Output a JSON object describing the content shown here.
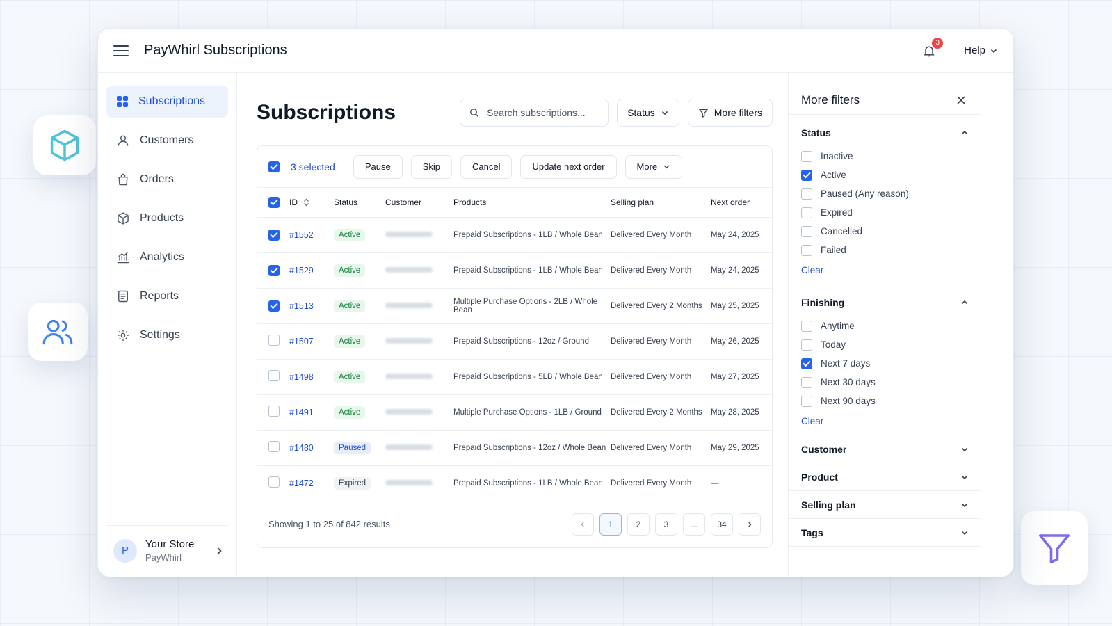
{
  "app": {
    "title": "PayWhirl Subscriptions",
    "notification_count": "3",
    "help_label": "Help"
  },
  "sidebar": {
    "items": [
      {
        "label": "Subscriptions",
        "icon": "grid-icon",
        "active": true
      },
      {
        "label": "Customers",
        "icon": "user-icon"
      },
      {
        "label": "Orders",
        "icon": "bag-icon"
      },
      {
        "label": "Products",
        "icon": "cube-icon"
      },
      {
        "label": "Analytics",
        "icon": "chart-icon"
      },
      {
        "label": "Reports",
        "icon": "document-icon"
      },
      {
        "label": "Settings",
        "icon": "gear-icon"
      }
    ],
    "footer": {
      "avatar_initial": "P",
      "store_name": "Your Store",
      "store_sub": "PayWhirl"
    }
  },
  "main": {
    "title": "Subscriptions",
    "search_placeholder": "Search subscriptions...",
    "status_filter_label": "Status",
    "more_filters_label": "More filters",
    "bulk": {
      "selected_label": "3 selected",
      "actions": [
        "Pause",
        "Skip",
        "Cancel",
        "Update next order"
      ],
      "more_label": "More"
    },
    "columns": {
      "id": "ID",
      "status": "Status",
      "customer": "Customer",
      "products": "Products",
      "plan": "Selling plan",
      "next": "Next order"
    },
    "rows": [
      {
        "checked": true,
        "id": "#1552",
        "status": "Active",
        "product": "Prepaid Subscriptions - 1LB / Whole Bean",
        "plan": "Delivered Every Month",
        "next": "May 24, 2025"
      },
      {
        "checked": true,
        "id": "#1529",
        "status": "Active",
        "product": "Prepaid Subscriptions - 1LB / Whole Bean",
        "plan": "Delivered Every Month",
        "next": "May 24, 2025"
      },
      {
        "checked": true,
        "id": "#1513",
        "status": "Active",
        "product": "Multiple Purchase Options - 2LB / Whole Bean",
        "plan": "Delivered Every 2 Months",
        "next": "May 25, 2025"
      },
      {
        "checked": false,
        "id": "#1507",
        "status": "Active",
        "product": "Prepaid Subscriptions - 12oz / Ground",
        "plan": "Delivered Every Month",
        "next": "May 26, 2025"
      },
      {
        "checked": false,
        "id": "#1498",
        "status": "Active",
        "product": "Prepaid Subscriptions - 5LB / Whole Bean",
        "plan": "Delivered Every Month",
        "next": "May 27, 2025"
      },
      {
        "checked": false,
        "id": "#1491",
        "status": "Active",
        "product": "Multiple Purchase Options - 1LB / Ground",
        "plan": "Delivered Every 2 Months",
        "next": "May 28, 2025"
      },
      {
        "checked": false,
        "id": "#1480",
        "status": "Paused",
        "product": "Prepaid Subscriptions - 12oz / Whole Bean",
        "plan": "Delivered Every Month",
        "next": "May 29, 2025"
      },
      {
        "checked": false,
        "id": "#1472",
        "status": "Expired",
        "product": "Prepaid Subscriptions - 1LB / Whole Bean",
        "plan": "Delivered Every Month",
        "next": "—"
      }
    ],
    "showing": "Showing 1 to 25 of 842 results",
    "pagination": {
      "pages": [
        "1",
        "2",
        "3",
        "...",
        "34"
      ],
      "current": "1"
    }
  },
  "filters": {
    "title": "More filters",
    "sections": [
      {
        "title": "Status",
        "expanded": true,
        "options": [
          {
            "label": "Inactive",
            "checked": false
          },
          {
            "label": "Active",
            "checked": true
          },
          {
            "label": "Paused (Any reason)",
            "checked": false
          },
          {
            "label": "Expired",
            "checked": false
          },
          {
            "label": "Cancelled",
            "checked": false
          },
          {
            "label": "Failed",
            "checked": false
          }
        ],
        "clear_label": "Clear"
      },
      {
        "title": "Finishing",
        "expanded": true,
        "options": [
          {
            "label": "Anytime",
            "checked": false
          },
          {
            "label": "Today",
            "checked": false
          },
          {
            "label": "Next 7 days",
            "checked": true
          },
          {
            "label": "Next 30 days",
            "checked": false
          },
          {
            "label": "Next 90 days",
            "checked": false
          }
        ],
        "clear_label": "Clear"
      },
      {
        "title": "Customer",
        "expanded": false
      },
      {
        "title": "Product",
        "expanded": false
      },
      {
        "title": "Selling plan",
        "expanded": false
      },
      {
        "title": "Tags",
        "expanded": false
      }
    ]
  },
  "colors": {
    "accent": "#2563eb",
    "active_green": "#15803d",
    "badge_red": "#ef4444",
    "float_icon": "#4fc3d9",
    "filter_icon": "#7c6cf0"
  }
}
